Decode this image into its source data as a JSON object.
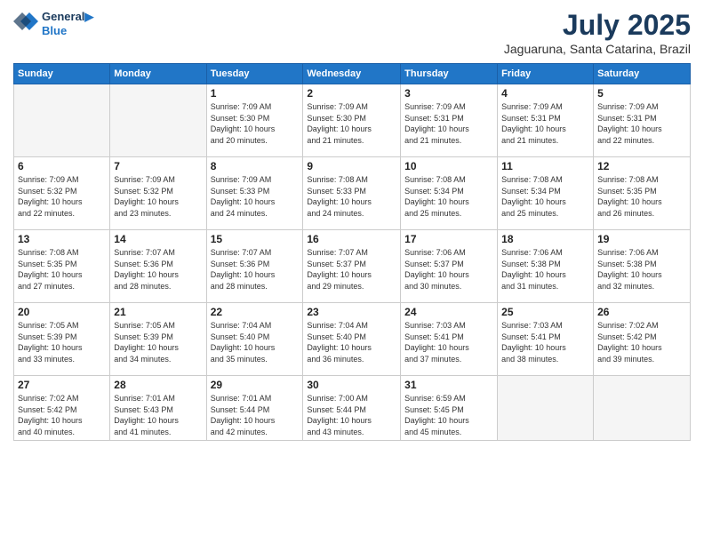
{
  "header": {
    "logo_line1": "General",
    "logo_line2": "Blue",
    "month_title": "July 2025",
    "subtitle": "Jaguaruna, Santa Catarina, Brazil"
  },
  "days_of_week": [
    "Sunday",
    "Monday",
    "Tuesday",
    "Wednesday",
    "Thursday",
    "Friday",
    "Saturday"
  ],
  "weeks": [
    [
      {
        "day": "",
        "info": ""
      },
      {
        "day": "",
        "info": ""
      },
      {
        "day": "1",
        "info": "Sunrise: 7:09 AM\nSunset: 5:30 PM\nDaylight: 10 hours\nand 20 minutes."
      },
      {
        "day": "2",
        "info": "Sunrise: 7:09 AM\nSunset: 5:30 PM\nDaylight: 10 hours\nand 21 minutes."
      },
      {
        "day": "3",
        "info": "Sunrise: 7:09 AM\nSunset: 5:31 PM\nDaylight: 10 hours\nand 21 minutes."
      },
      {
        "day": "4",
        "info": "Sunrise: 7:09 AM\nSunset: 5:31 PM\nDaylight: 10 hours\nand 21 minutes."
      },
      {
        "day": "5",
        "info": "Sunrise: 7:09 AM\nSunset: 5:31 PM\nDaylight: 10 hours\nand 22 minutes."
      }
    ],
    [
      {
        "day": "6",
        "info": "Sunrise: 7:09 AM\nSunset: 5:32 PM\nDaylight: 10 hours\nand 22 minutes."
      },
      {
        "day": "7",
        "info": "Sunrise: 7:09 AM\nSunset: 5:32 PM\nDaylight: 10 hours\nand 23 minutes."
      },
      {
        "day": "8",
        "info": "Sunrise: 7:09 AM\nSunset: 5:33 PM\nDaylight: 10 hours\nand 24 minutes."
      },
      {
        "day": "9",
        "info": "Sunrise: 7:08 AM\nSunset: 5:33 PM\nDaylight: 10 hours\nand 24 minutes."
      },
      {
        "day": "10",
        "info": "Sunrise: 7:08 AM\nSunset: 5:34 PM\nDaylight: 10 hours\nand 25 minutes."
      },
      {
        "day": "11",
        "info": "Sunrise: 7:08 AM\nSunset: 5:34 PM\nDaylight: 10 hours\nand 25 minutes."
      },
      {
        "day": "12",
        "info": "Sunrise: 7:08 AM\nSunset: 5:35 PM\nDaylight: 10 hours\nand 26 minutes."
      }
    ],
    [
      {
        "day": "13",
        "info": "Sunrise: 7:08 AM\nSunset: 5:35 PM\nDaylight: 10 hours\nand 27 minutes."
      },
      {
        "day": "14",
        "info": "Sunrise: 7:07 AM\nSunset: 5:36 PM\nDaylight: 10 hours\nand 28 minutes."
      },
      {
        "day": "15",
        "info": "Sunrise: 7:07 AM\nSunset: 5:36 PM\nDaylight: 10 hours\nand 28 minutes."
      },
      {
        "day": "16",
        "info": "Sunrise: 7:07 AM\nSunset: 5:37 PM\nDaylight: 10 hours\nand 29 minutes."
      },
      {
        "day": "17",
        "info": "Sunrise: 7:06 AM\nSunset: 5:37 PM\nDaylight: 10 hours\nand 30 minutes."
      },
      {
        "day": "18",
        "info": "Sunrise: 7:06 AM\nSunset: 5:38 PM\nDaylight: 10 hours\nand 31 minutes."
      },
      {
        "day": "19",
        "info": "Sunrise: 7:06 AM\nSunset: 5:38 PM\nDaylight: 10 hours\nand 32 minutes."
      }
    ],
    [
      {
        "day": "20",
        "info": "Sunrise: 7:05 AM\nSunset: 5:39 PM\nDaylight: 10 hours\nand 33 minutes."
      },
      {
        "day": "21",
        "info": "Sunrise: 7:05 AM\nSunset: 5:39 PM\nDaylight: 10 hours\nand 34 minutes."
      },
      {
        "day": "22",
        "info": "Sunrise: 7:04 AM\nSunset: 5:40 PM\nDaylight: 10 hours\nand 35 minutes."
      },
      {
        "day": "23",
        "info": "Sunrise: 7:04 AM\nSunset: 5:40 PM\nDaylight: 10 hours\nand 36 minutes."
      },
      {
        "day": "24",
        "info": "Sunrise: 7:03 AM\nSunset: 5:41 PM\nDaylight: 10 hours\nand 37 minutes."
      },
      {
        "day": "25",
        "info": "Sunrise: 7:03 AM\nSunset: 5:41 PM\nDaylight: 10 hours\nand 38 minutes."
      },
      {
        "day": "26",
        "info": "Sunrise: 7:02 AM\nSunset: 5:42 PM\nDaylight: 10 hours\nand 39 minutes."
      }
    ],
    [
      {
        "day": "27",
        "info": "Sunrise: 7:02 AM\nSunset: 5:42 PM\nDaylight: 10 hours\nand 40 minutes."
      },
      {
        "day": "28",
        "info": "Sunrise: 7:01 AM\nSunset: 5:43 PM\nDaylight: 10 hours\nand 41 minutes."
      },
      {
        "day": "29",
        "info": "Sunrise: 7:01 AM\nSunset: 5:44 PM\nDaylight: 10 hours\nand 42 minutes."
      },
      {
        "day": "30",
        "info": "Sunrise: 7:00 AM\nSunset: 5:44 PM\nDaylight: 10 hours\nand 43 minutes."
      },
      {
        "day": "31",
        "info": "Sunrise: 6:59 AM\nSunset: 5:45 PM\nDaylight: 10 hours\nand 45 minutes."
      },
      {
        "day": "",
        "info": ""
      },
      {
        "day": "",
        "info": ""
      }
    ]
  ]
}
